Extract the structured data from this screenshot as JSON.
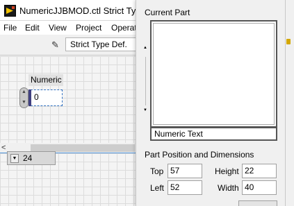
{
  "window": {
    "title": "NumericJJBMOD.ctl Strict Type"
  },
  "menu": {
    "items": [
      "File",
      "Edit",
      "View",
      "Project",
      "Operat"
    ]
  },
  "toolbar": {
    "type_def": "Strict Type Def."
  },
  "front_panel": {
    "numeric_label": "Numeric",
    "numeric_value": "0",
    "terminal_value": "24"
  },
  "panel": {
    "current_part_label": "Current Part",
    "part_name": "Numeric Text",
    "pos_dim_label": "Part Position and Dimensions",
    "top_label": "Top",
    "top_value": "57",
    "left_label": "Left",
    "left_value": "52",
    "height_label": "Height",
    "height_value": "22",
    "width_label": "Width",
    "width_value": "40"
  },
  "icons": {
    "app": "labview-icon",
    "edit": "pencil-icon",
    "scroll_left": "chevron-left-icon",
    "terminal_dropdown": "chevron-down-icon"
  }
}
